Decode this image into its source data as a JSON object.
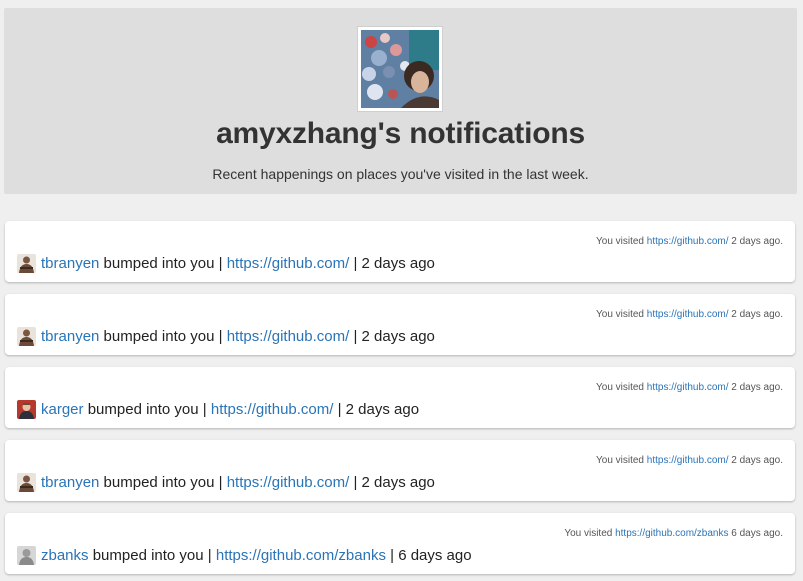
{
  "header": {
    "title": "amyxzhang's notifications",
    "subtitle": "Recent happenings on places you've visited in the last week.",
    "avatar_icon": "profile-photo"
  },
  "notifications": [
    {
      "user": "tbranyen",
      "avatar_icon": "user-avatar-tbranyen",
      "action": "bumped into you",
      "link": "https://github.com/",
      "time": "2 days ago",
      "meta_prefix": "You visited",
      "meta_link": "https://github.com/",
      "meta_time": "2 days ago."
    },
    {
      "user": "tbranyen",
      "avatar_icon": "user-avatar-tbranyen",
      "action": "bumped into you",
      "link": "https://github.com/",
      "time": "2 days ago",
      "meta_prefix": "You visited",
      "meta_link": "https://github.com/",
      "meta_time": "2 days ago."
    },
    {
      "user": "karger",
      "avatar_icon": "user-avatar-karger",
      "action": "bumped into you",
      "link": "https://github.com/",
      "time": "2 days ago",
      "meta_prefix": "You visited",
      "meta_link": "https://github.com/",
      "meta_time": "2 days ago."
    },
    {
      "user": "tbranyen",
      "avatar_icon": "user-avatar-tbranyen",
      "action": "bumped into you",
      "link": "https://github.com/",
      "time": "2 days ago",
      "meta_prefix": "You visited",
      "meta_link": "https://github.com/",
      "meta_time": "2 days ago."
    },
    {
      "user": "zbanks",
      "avatar_icon": "user-avatar-zbanks",
      "action": "bumped into you",
      "link": "https://github.com/zbanks",
      "time": "6 days ago",
      "meta_prefix": "You visited",
      "meta_link": "https://github.com/zbanks",
      "meta_time": "6 days ago."
    }
  ],
  "colors": {
    "link": "#2a74b8",
    "header_bg": "#dedede",
    "page_bg": "#efefef"
  }
}
